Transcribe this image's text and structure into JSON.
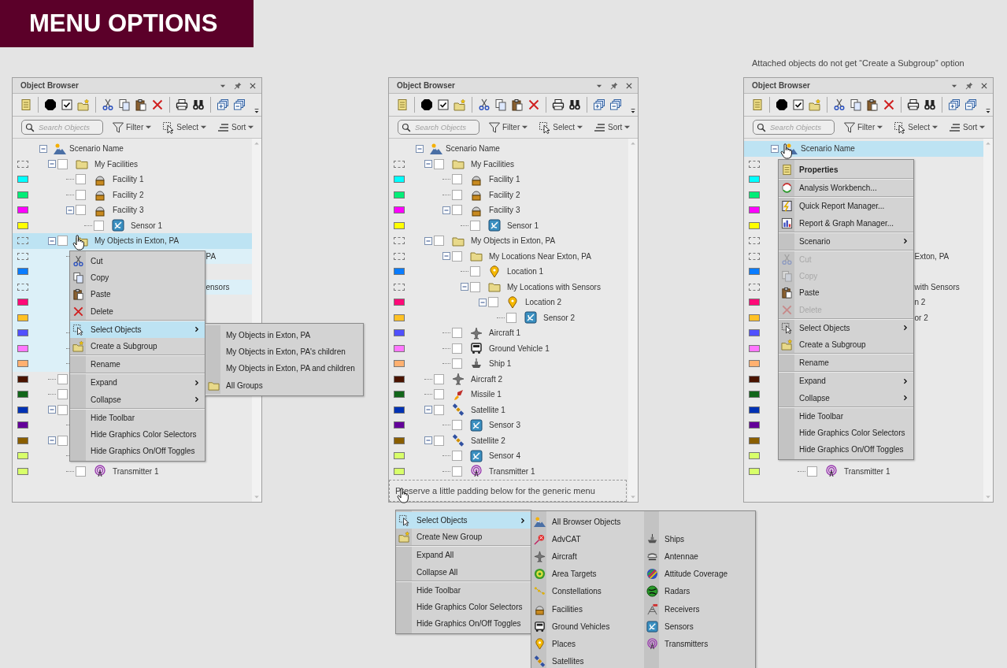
{
  "banner": "MENU OPTIONS",
  "note": "Attached objects do not get “Create a Subgroup” option",
  "panels": [
    {
      "title": "Object Browser",
      "search": {
        "placeholder": "Search Objects"
      },
      "tools": [
        {
          "kind": "filter",
          "label": "Filter"
        },
        {
          "kind": "select",
          "label": "Select"
        },
        {
          "kind": "sort",
          "label": "Sort"
        }
      ],
      "tree": {
        "label": "Scenario Name",
        "kind": "scenario",
        "expanded": true,
        "selected": false,
        "highlighted": false,
        "children": [
          {
            "label": "My Facilities",
            "kind": "folder",
            "checked": false,
            "expanded": true,
            "selected": false,
            "highlighted": false,
            "children": [
              {
                "label": "Facility 1",
                "kind": "facility",
                "color": "#00ffff",
                "checked": false,
                "selected": false,
                "highlighted": false
              },
              {
                "label": "Facility 2",
                "kind": "facility",
                "color": "#00ee77",
                "checked": false,
                "selected": false,
                "highlighted": false
              },
              {
                "label": "Facility 3",
                "kind": "facility",
                "color": "#ff00ff",
                "checked": false,
                "expanded": true,
                "selected": false,
                "highlighted": false,
                "children": [
                  {
                    "label": "Sensor 1",
                    "kind": "sensor",
                    "color": "#ffff00",
                    "checked": false,
                    "selected": false,
                    "highlighted": false
                  }
                ]
              }
            ]
          },
          {
            "label": "My Objects in Exton, PA",
            "kind": "folder",
            "checked": false,
            "expanded": true,
            "selected": true,
            "highlighted": false,
            "children": [
              {
                "label": "PA",
                "clipped": true,
                "selected": false,
                "highlighted": true,
                "children": [
                  {
                    "color": "#0a7cff",
                    "selected": false,
                    "highlighted": true
                  },
                  {
                    "label": "ensors",
                    "clipped": true,
                    "selected": false,
                    "highlighted": true,
                    "children": [
                      {
                        "color": "#ff0a78",
                        "selected": false,
                        "highlighted": true,
                        "children": [
                          {
                            "color": "#ffc125",
                            "selected": false,
                            "highlighted": true
                          }
                        ]
                      }
                    ]
                  }
                ]
              },
              {
                "color": "#5050ff",
                "selected": false,
                "highlighted": true
              },
              {
                "color": "#ff77ff",
                "selected": false,
                "highlighted": true
              },
              {
                "color": "#ffb070",
                "selected": false,
                "highlighted": true
              }
            ]
          },
          {
            "color": "#4a1400",
            "checked": false,
            "selected": false,
            "highlighted": false
          },
          {
            "color": "#12661a",
            "checked": false,
            "selected": false,
            "highlighted": false
          },
          {
            "color": "#0032b4",
            "checked": false,
            "expanded": true,
            "selected": false,
            "highlighted": false,
            "children": [
              {
                "color": "#64009a",
                "selected": false,
                "highlighted": false
              }
            ]
          },
          {
            "color": "#8a5e00",
            "checked": false,
            "expanded": true,
            "selected": false,
            "highlighted": false,
            "children": [
              {
                "color": "#d8ff6a",
                "selected": false,
                "highlighted": false
              },
              {
                "label": "Transmitter 1",
                "kind": "transmitter",
                "color": "#d8ff6a",
                "checked": false,
                "selected": false,
                "highlighted": false
              }
            ]
          }
        ]
      },
      "menu": {
        "sections": [
          [
            {
              "label": "Cut",
              "kind": "cut",
              "submenu": false,
              "selected": false
            },
            {
              "label": "Copy",
              "kind": "copy",
              "submenu": false,
              "selected": false
            },
            {
              "label": "Paste",
              "kind": "paste",
              "submenu": false,
              "selected": false
            },
            {
              "label": "Delete",
              "kind": "delete",
              "submenu": false,
              "selected": false
            }
          ],
          [
            {
              "label": "Select Objects",
              "kind": "select",
              "submenu": true,
              "selected": true
            },
            {
              "label": "Create a Subgroup",
              "kind": "new-group",
              "submenu": false,
              "selected": false
            }
          ],
          [
            {
              "label": "Rename",
              "submenu": false,
              "selected": false
            }
          ],
          [
            {
              "label": "Expand",
              "submenu": true,
              "selected": false
            },
            {
              "label": "Collapse",
              "submenu": true,
              "selected": false
            }
          ],
          [
            {
              "label": "Hide Toolbar",
              "submenu": false,
              "selected": false
            },
            {
              "label": "Hide Graphics Color Selectors",
              "submenu": false,
              "selected": false
            },
            {
              "label": "Hide Graphics On/Off Toggles",
              "submenu": false,
              "selected": false
            }
          ]
        ]
      },
      "submenu": {
        "columns": [
          [
            {
              "label": "My Objects in Exton, PA",
              "selected": false
            },
            {
              "label": "My Objects in Exton, PA's children",
              "selected": false
            },
            {
              "label": "My Objects in Exton, PA and children",
              "selected": false
            },
            {
              "label": "All Groups",
              "kind": "folder",
              "selected": false
            }
          ]
        ]
      }
    },
    {
      "title": "Object Browser",
      "search": {
        "placeholder": "Search Objects"
      },
      "tools": [
        {
          "kind": "filter",
          "label": "Filter"
        },
        {
          "kind": "select",
          "label": "Select"
        },
        {
          "kind": "sort",
          "label": "Sort"
        }
      ],
      "tree": {
        "label": "Scenario Name",
        "kind": "scenario",
        "expanded": true,
        "selected": false,
        "highlighted": false,
        "children": [
          {
            "label": "My Facilities",
            "kind": "folder",
            "checked": false,
            "expanded": true,
            "selected": false,
            "highlighted": false,
            "children": [
              {
                "label": "Facility 1",
                "kind": "facility",
                "color": "#00ffff",
                "checked": false,
                "selected": false,
                "highlighted": false
              },
              {
                "label": "Facility 2",
                "kind": "facility",
                "color": "#00ee77",
                "checked": false,
                "selected": false,
                "highlighted": false
              },
              {
                "label": "Facility 3",
                "kind": "facility",
                "color": "#ff00ff",
                "checked": false,
                "expanded": true,
                "selected": false,
                "highlighted": false,
                "children": [
                  {
                    "label": "Sensor 1",
                    "kind": "sensor",
                    "color": "#ffff00",
                    "checked": false,
                    "selected": false,
                    "highlighted": false
                  }
                ]
              }
            ]
          },
          {
            "label": "My Objects in Exton, PA",
            "kind": "folder",
            "checked": false,
            "expanded": true,
            "selected": false,
            "highlighted": false,
            "children": [
              {
                "label": "My Locations Near Exton, PA",
                "kind": "folder",
                "checked": false,
                "expanded": true,
                "selected": false,
                "highlighted": false,
                "children": [
                  {
                    "label": "Location 1",
                    "kind": "place",
                    "color": "#0a7cff",
                    "checked": false,
                    "selected": false,
                    "highlighted": false
                  },
                  {
                    "label": "My Locations with Sensors",
                    "kind": "folder",
                    "checked": false,
                    "expanded": true,
                    "selected": false,
                    "highlighted": false,
                    "children": [
                      {
                        "label": "Location 2",
                        "kind": "place",
                        "color": "#ff0a78",
                        "checked": false,
                        "expanded": true,
                        "selected": false,
                        "highlighted": false,
                        "children": [
                          {
                            "label": "Sensor 2",
                            "kind": "sensor",
                            "color": "#ffc125",
                            "checked": false,
                            "selected": false,
                            "highlighted": false
                          }
                        ]
                      }
                    ]
                  }
                ]
              },
              {
                "label": "Aircraft 1",
                "kind": "aircraft",
                "color": "#5050ff",
                "checked": false,
                "selected": false,
                "highlighted": false
              },
              {
                "label": "Ground Vehicle 1",
                "kind": "ground-vehicle",
                "color": "#ff77ff",
                "checked": false,
                "selected": false,
                "highlighted": false
              },
              {
                "label": "Ship 1",
                "kind": "ship",
                "color": "#ffb070",
                "checked": false,
                "selected": false,
                "highlighted": false
              }
            ]
          },
          {
            "label": "Aircraft 2",
            "kind": "aircraft",
            "color": "#4a1400",
            "checked": false,
            "selected": false,
            "highlighted": false
          },
          {
            "label": "Missile 1",
            "kind": "missile",
            "color": "#12661a",
            "checked": false,
            "selected": false,
            "highlighted": false
          },
          {
            "label": "Satellite 1",
            "kind": "satellite",
            "color": "#0032b4",
            "checked": false,
            "expanded": true,
            "selected": false,
            "highlighted": false,
            "children": [
              {
                "label": "Sensor 3",
                "kind": "sensor",
                "color": "#64009a",
                "checked": false,
                "selected": false,
                "highlighted": false
              }
            ]
          },
          {
            "label": "Satellite 2",
            "kind": "satellite",
            "color": "#8a5e00",
            "checked": false,
            "expanded": true,
            "selected": false,
            "highlighted": false,
            "children": [
              {
                "label": "Sensor 4",
                "kind": "sensor",
                "color": "#d8ff6a",
                "checked": false,
                "selected": false,
                "highlighted": false
              },
              {
                "label": "Transmitter 1",
                "kind": "transmitter",
                "color": "#d8ff6a",
                "checked": false,
                "selected": false,
                "highlighted": false
              }
            ]
          }
        ]
      },
      "hint": "Preserve a little padding below for the generic menu",
      "menu": {
        "sections": [
          [
            {
              "label": "Select Objects",
              "kind": "select",
              "submenu": true,
              "selected": true
            },
            {
              "label": "Create New Group",
              "kind": "new-group",
              "submenu": false,
              "selected": false
            }
          ],
          [
            {
              "label": "Expand All",
              "submenu": false,
              "selected": false
            },
            {
              "label": "Collapse All",
              "submenu": false,
              "selected": false
            }
          ],
          [
            {
              "label": "Hide Toolbar",
              "submenu": false,
              "selected": false
            },
            {
              "label": "Hide Graphics Color Selectors",
              "submenu": false,
              "selected": false
            },
            {
              "label": "Hide Graphics On/Off Toggles",
              "submenu": false,
              "selected": false
            }
          ]
        ]
      },
      "submenu": {
        "columns": [
          [
            {
              "label": "All Browser Objects",
              "kind": "scenario",
              "selected": false
            },
            {
              "label": "AdvCAT",
              "kind": "advcat",
              "selected": false
            },
            {
              "label": "Aircraft",
              "kind": "aircraft",
              "selected": false
            },
            {
              "label": "Area Targets",
              "kind": "area-target",
              "selected": false
            },
            {
              "label": "Constellations",
              "kind": "constellation",
              "selected": false
            },
            {
              "label": "Facilities",
              "kind": "facility",
              "selected": false
            },
            {
              "label": "Ground Vehicles",
              "kind": "ground-vehicle",
              "selected": false
            },
            {
              "label": "Places",
              "kind": "place",
              "selected": false
            },
            {
              "label": "Satellites",
              "kind": "satellite",
              "selected": false
            }
          ],
          [
            {
              "label": "Ships",
              "kind": "ship",
              "selected": false
            },
            {
              "label": "Antennae",
              "kind": "antenna",
              "selected": false
            },
            {
              "label": "Attitude Coverage",
              "kind": "attitude-coverage",
              "selected": false
            },
            {
              "label": "Radars",
              "kind": "radar",
              "selected": false
            },
            {
              "label": "Receivers",
              "kind": "receiver",
              "selected": false
            },
            {
              "label": "Sensors",
              "kind": "sensor",
              "selected": false
            },
            {
              "label": "Transmitters",
              "kind": "transmitter",
              "selected": false
            }
          ]
        ]
      }
    },
    {
      "title": "Object Browser",
      "search": {
        "placeholder": "Search Objects"
      },
      "tools": [
        {
          "kind": "filter",
          "label": "Filter"
        },
        {
          "kind": "select",
          "label": "Select"
        },
        {
          "kind": "sort",
          "label": "Sort"
        }
      ],
      "tree": {
        "label": "Scenario Name",
        "kind": "scenario",
        "expanded": true,
        "selected": true,
        "highlighted": false,
        "children": [
          {
            "selected": false,
            "highlighted": false,
            "children": [
              {
                "color": "#00ffff",
                "selected": false,
                "highlighted": false
              },
              {
                "color": "#00ee77",
                "selected": false,
                "highlighted": false
              },
              {
                "color": "#ff00ff",
                "selected": false,
                "highlighted": false,
                "children": [
                  {
                    "color": "#ffff00",
                    "selected": false,
                    "highlighted": false
                  }
                ]
              }
            ]
          },
          {
            "selected": false,
            "highlighted": false,
            "children": [
              {
                "label": "Exton, PA",
                "clipped": true,
                "selected": false,
                "highlighted": false,
                "children": [
                  {
                    "color": "#0a7cff",
                    "selected": false,
                    "highlighted": false
                  },
                  {
                    "label": "with Sensors",
                    "clipped": true,
                    "selected": false,
                    "highlighted": false,
                    "children": [
                      {
                        "label": "n 2",
                        "clipped": true,
                        "color": "#ff0a78",
                        "selected": false,
                        "highlighted": false,
                        "children": [
                          {
                            "label": "or 2",
                            "clipped": true,
                            "color": "#ffc125",
                            "selected": false,
                            "highlighted": false
                          }
                        ]
                      }
                    ]
                  }
                ]
              },
              {
                "color": "#5050ff",
                "selected": false,
                "highlighted": false
              },
              {
                "color": "#ff77ff",
                "selected": false,
                "highlighted": false
              },
              {
                "color": "#ffb070",
                "selected": false,
                "highlighted": false
              }
            ]
          },
          {
            "color": "#4a1400",
            "selected": false,
            "highlighted": false
          },
          {
            "color": "#12661a",
            "selected": false,
            "highlighted": false
          },
          {
            "color": "#0032b4",
            "selected": false,
            "highlighted": false,
            "children": [
              {
                "color": "#64009a",
                "selected": false,
                "highlighted": false
              }
            ]
          },
          {
            "color": "#8a5e00",
            "selected": false,
            "highlighted": false,
            "children": [
              {
                "color": "#d8ff6a",
                "selected": false,
                "highlighted": false
              },
              {
                "label": "Transmitter 1",
                "kind": "transmitter",
                "color": "#d8ff6a",
                "checked": false,
                "selected": false,
                "highlighted": false
              }
            ]
          }
        ]
      },
      "menu": {
        "sections": [
          [
            {
              "label": "Properties",
              "kind": "properties",
              "submenu": false,
              "selected": false,
              "disabled": false,
              "default": true
            }
          ],
          [
            {
              "label": "Analysis Workbench...",
              "kind": "workbench",
              "submenu": false,
              "selected": false,
              "disabled": false
            }
          ],
          [
            {
              "label": "Quick Report Manager...",
              "kind": "quick-report",
              "submenu": false,
              "selected": false,
              "disabled": false
            },
            {
              "label": "Report & Graph Manager...",
              "kind": "report-graph",
              "submenu": false,
              "selected": false,
              "disabled": false
            }
          ],
          [
            {
              "label": "Scenario",
              "submenu": true,
              "selected": false,
              "disabled": false
            }
          ],
          [
            {
              "label": "Cut",
              "kind": "cut",
              "submenu": false,
              "selected": false,
              "disabled": true
            },
            {
              "label": "Copy",
              "kind": "copy",
              "submenu": false,
              "selected": false,
              "disabled": true
            },
            {
              "label": "Paste",
              "kind": "paste",
              "submenu": false,
              "selected": false,
              "disabled": false
            },
            {
              "label": "Delete",
              "kind": "delete",
              "submenu": false,
              "selected": false,
              "disabled": true
            }
          ],
          [
            {
              "label": "Select Objects",
              "kind": "select",
              "submenu": true,
              "selected": false,
              "disabled": false
            },
            {
              "label": "Create a Subgroup",
              "kind": "new-group",
              "submenu": false,
              "selected": false,
              "disabled": false
            }
          ],
          [
            {
              "label": "Rename",
              "submenu": false,
              "selected": false,
              "disabled": false
            }
          ],
          [
            {
              "label": "Expand",
              "submenu": true,
              "selected": false,
              "disabled": false
            },
            {
              "label": "Collapse",
              "submenu": true,
              "selected": false,
              "disabled": false
            }
          ],
          [
            {
              "label": "Hide Toolbar",
              "submenu": false,
              "selected": false,
              "disabled": false
            },
            {
              "label": "Hide Graphics Color Selectors",
              "submenu": false,
              "selected": false,
              "disabled": false
            },
            {
              "label": "Hide Graphics On/Off Toggles",
              "submenu": false,
              "selected": false,
              "disabled": false
            }
          ]
        ]
      }
    }
  ]
}
